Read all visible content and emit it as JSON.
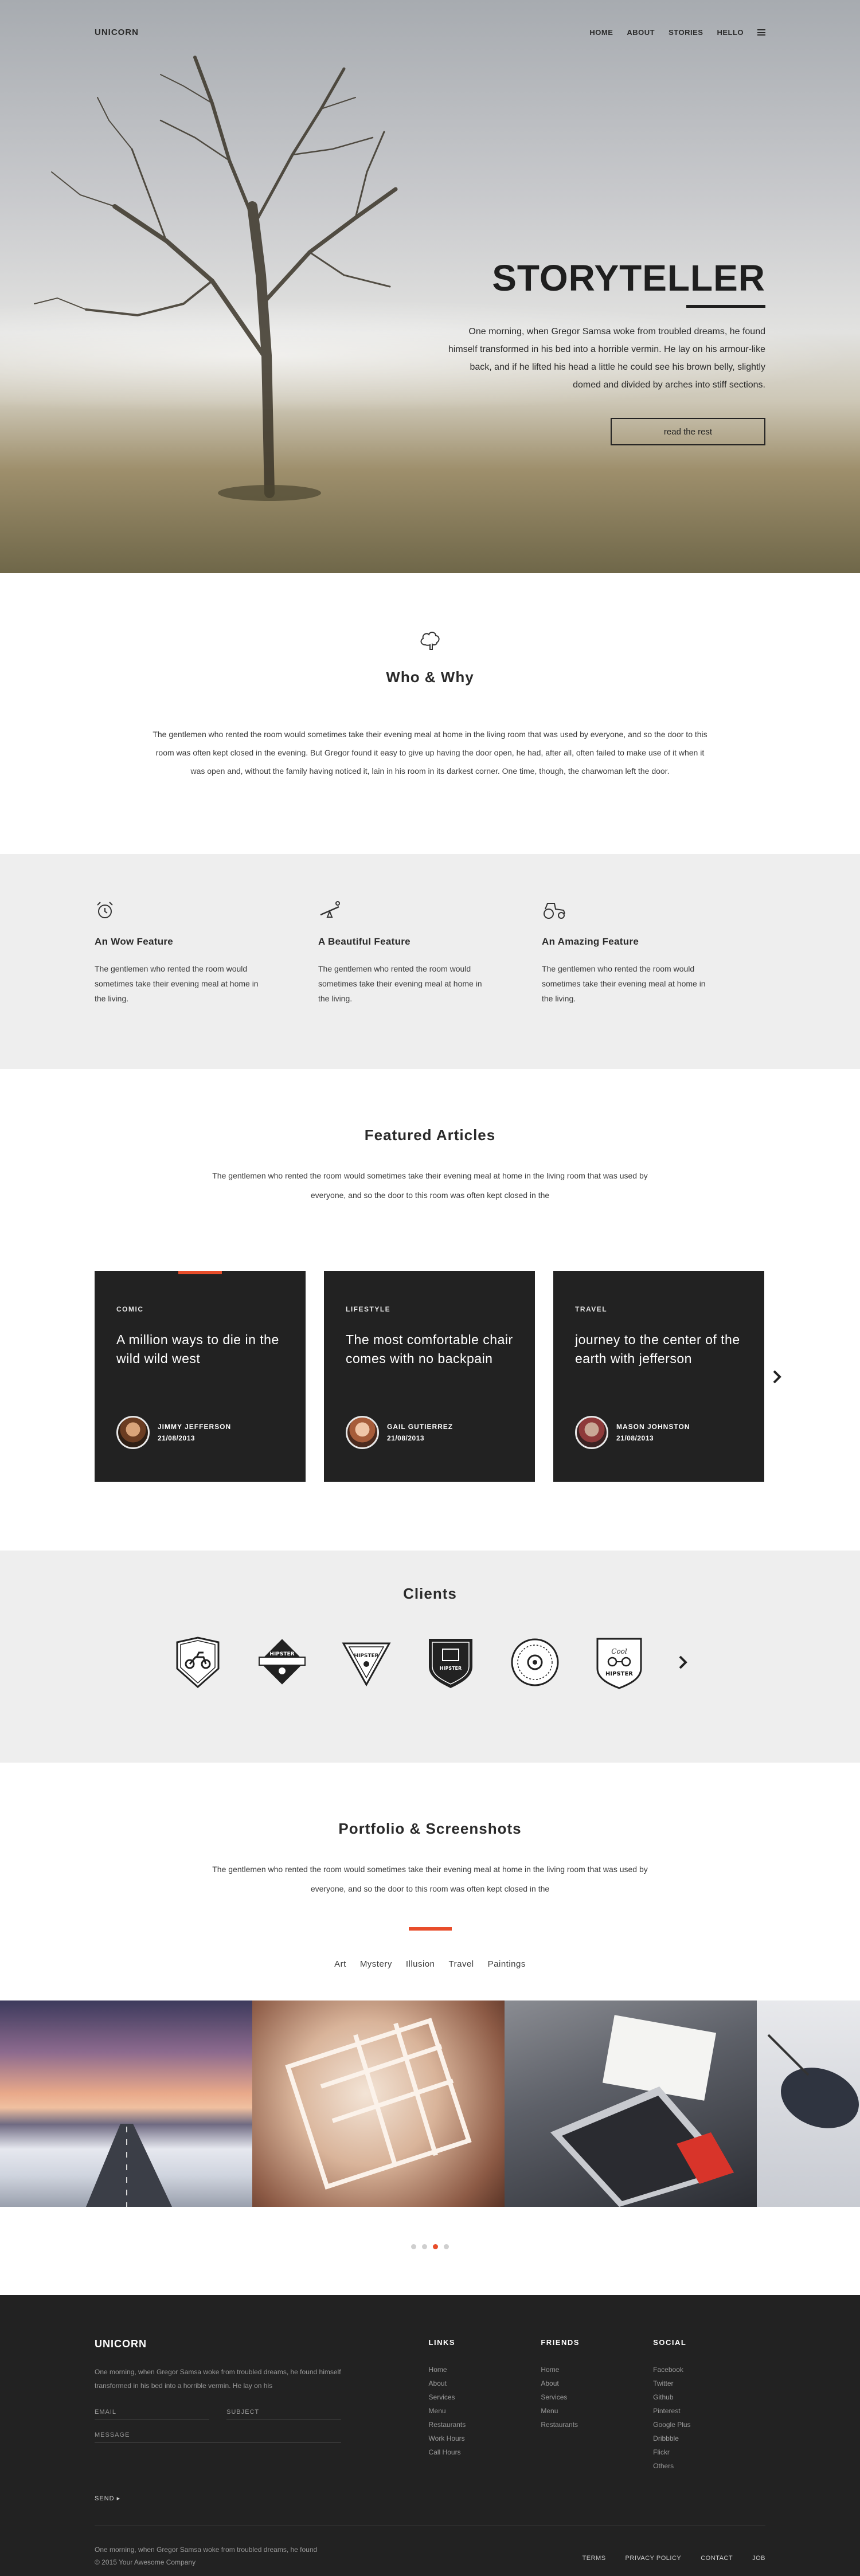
{
  "header": {
    "logo": "UNICORN",
    "nav": [
      "HOME",
      "ABOUT",
      "STORIES",
      "HELLO"
    ]
  },
  "hero": {
    "title": "STORYTELLER",
    "description": "One morning, when Gregor Samsa woke from troubled dreams, he found himself transformed in his bed into a horrible vermin. He lay on his armour-like back, and if he lifted his head a little he could see his brown belly, slightly domed and divided by arches into stiff sections.",
    "button": "read the rest"
  },
  "who": {
    "title": "Who & Why",
    "text": "The gentlemen who rented the room would sometimes take their evening meal at home in the living room that was used by everyone, and so the door to this room was often kept closed in the evening. But Gregor found it easy to give up having the door open, he had, after all, often failed to make use of it when it was open and, without the family having noticed it, lain in his room in its darkest corner. One time, though, the charwoman left the door."
  },
  "features": [
    {
      "icon": "alarm-clock-icon",
      "title": "An Wow Feature",
      "text": "The gentlemen who rented the room would sometimes take their evening meal at home in the living."
    },
    {
      "icon": "seesaw-icon",
      "title": "A Beautiful Feature",
      "text": "The gentlemen who rented the room would sometimes take their evening meal at home in the living."
    },
    {
      "icon": "tractor-icon",
      "title": "An Amazing Feature",
      "text": "The gentlemen who rented the room would sometimes take their evening meal at home in the living."
    }
  ],
  "articles": {
    "title": "Featured Articles",
    "intro": "The gentlemen who rented the room would sometimes take their evening meal at home in the living room that was used by everyone, and so the door to this room was often kept closed in the",
    "cards": [
      {
        "category": "COMIC",
        "title": "A million ways to die in the wild wild west",
        "author": "JIMMY JEFFERSON",
        "date": "21/08/2013"
      },
      {
        "category": "LIFESTYLE",
        "title": "The most comfortable chair comes with no backpain",
        "author": "GAIL GUTIERREZ",
        "date": "21/08/2013"
      },
      {
        "category": "TRAVEL",
        "title": "journey to the center of the earth with jefferson",
        "author": "MASON JOHNSTON",
        "date": "21/08/2013"
      }
    ]
  },
  "clients": {
    "title": "Clients",
    "logos": [
      {
        "name": "client-logo-motorbike",
        "text": ""
      },
      {
        "name": "client-logo-hipster-diamond",
        "text": "HIPSTER"
      },
      {
        "name": "client-logo-hipster-triangle",
        "text": "HIPSTER"
      },
      {
        "name": "client-logo-shield",
        "text": "HIPSTER"
      },
      {
        "name": "client-logo-circle",
        "text": ""
      },
      {
        "name": "client-logo-hipster-badge",
        "text": "HIPSTER"
      }
    ]
  },
  "portfolio": {
    "title": "Portfolio & Screenshots",
    "intro": "The gentlemen who rented the room would sometimes take their evening meal at home in the living room that was used by everyone, and so the door to this room was often kept closed in the",
    "filters": [
      "Art",
      "Mystery",
      "Illusion",
      "Travel",
      "Paintings"
    ],
    "active_dot": 2
  },
  "footer": {
    "logo": "UNICORN",
    "about": "One morning, when Gregor Samsa woke from troubled dreams, he found himself transformed in his bed into a horrible vermin. He lay on his",
    "email_placeholder": "EMAIL",
    "subject_placeholder": "SUBJECT",
    "message_placeholder": "MESSAGE",
    "send": "SEND",
    "links": {
      "title": "LINKS",
      "items": [
        "Home",
        "About",
        "Services",
        "Menu",
        "Restaurants",
        "Work Hours",
        "Call Hours"
      ]
    },
    "friends": {
      "title": "FRIENDS",
      "items": [
        "Home",
        "About",
        "Services",
        "Menu",
        "Restaurants"
      ]
    },
    "social": {
      "title": "SOCIAL",
      "items": [
        "Facebook",
        "Twitter",
        "Github",
        "Pinterest",
        "Google Plus",
        "Dribbble",
        "Flickr",
        "Others"
      ]
    },
    "bottom_text": "One morning, when Gregor Samsa woke from troubled dreams, he found",
    "copyright": "© 2015 Your Awesome Company",
    "bottom_links": [
      "TERMS",
      "PRIVACY POLICY",
      "CONTACT",
      "JOB"
    ]
  },
  "colors": {
    "accent": "#e84d2a",
    "dark": "#222222",
    "light": "#eeeeee"
  }
}
